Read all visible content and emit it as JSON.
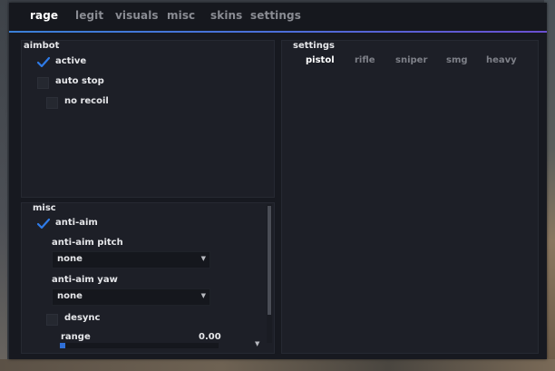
{
  "tabs": [
    "rage",
    "legit",
    "visuals",
    "misc",
    "skins",
    "settings"
  ],
  "aimbot": {
    "title": "aimbot",
    "active_label": "active",
    "autostop_label": "auto stop",
    "norecoil_label": "no recoil"
  },
  "settings": {
    "title": "settings",
    "weapon_tabs": [
      "pistol",
      "rifle",
      "sniper",
      "smg",
      "heavy"
    ]
  },
  "misc": {
    "title": "misc",
    "antiaim_label": "anti-aim",
    "pitch_label": "anti-aim pitch",
    "pitch_value": "none",
    "yaw_label": "anti-aim yaw",
    "yaw_value": "none",
    "desync_label": "desync",
    "range_label": "range",
    "range_value": "0.00",
    "range_fraction": 0.0
  },
  "colors": {
    "accent": "#2f6fd6",
    "check": "#2f7be8"
  },
  "icons": {
    "check": "check-icon",
    "dropdown": "chevron-down-icon"
  }
}
